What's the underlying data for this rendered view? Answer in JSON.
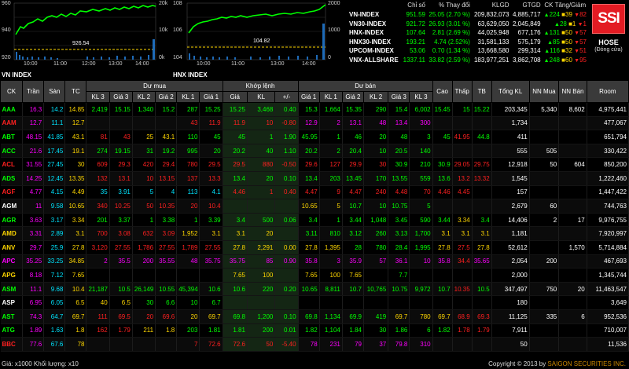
{
  "charts": [
    {
      "title": "VN INDEX",
      "y_left": [
        "960",
        "940",
        "920"
      ],
      "y_right": [
        "20k",
        "10k",
        "0k"
      ],
      "x": [
        "10:00",
        "11:00",
        "12:00",
        "13:00",
        "14:00"
      ],
      "ref_value": "926.54"
    },
    {
      "title": "HNX INDEX",
      "y_left": [
        "108",
        "106",
        "104"
      ],
      "y_right": [
        "2000",
        "1000",
        "0"
      ],
      "x": [
        "10:00",
        "11:00",
        "13:00",
        "14:00"
      ],
      "ref_value": "104.82"
    }
  ],
  "indices": {
    "headers": [
      "",
      "Chỉ số",
      "% Thay đổi",
      "KLGD",
      "GTGD",
      "CK Tăng/Giảm"
    ],
    "rows": [
      {
        "name": "VN-INDEX",
        "value": "951.59",
        "change": "25.05 (2.70 %)",
        "vol": "209,832,073",
        "val": "4,885,717",
        "up": "224",
        "ref": "39",
        "down": "82"
      },
      {
        "name": "VN30-INDEX",
        "value": "921.72",
        "change": "26.93 (3.01 %)",
        "vol": "63,629,050",
        "val": "2,045,849",
        "up": "28",
        "ref": "1",
        "down": "1"
      },
      {
        "name": "HNX-INDEX",
        "value": "107.64",
        "change": "2.81 (2.69 %)",
        "vol": "44,025,948",
        "val": "677,176",
        "up": "131",
        "ref": "50",
        "down": "57"
      },
      {
        "name": "HNX30-INDEX",
        "value": "193.21",
        "change": "4.74 (2.52%)",
        "vol": "31,581,133",
        "val": "575,179",
        "up": "85",
        "ref": "50",
        "down": "57"
      },
      {
        "name": "UPCOM-INDEX",
        "value": "53.06",
        "change": "0.70 (1.34 %)",
        "vol": "13,668,580",
        "val": "299,314",
        "up": "116",
        "ref": "32",
        "down": "51"
      },
      {
        "name": "VNX-ALLSHARE",
        "value": "1337.11",
        "change": "33.82 (2.59 %)",
        "vol": "183,977,251",
        "val": "3,862,708",
        "up": "248",
        "ref": "60",
        "down": "95"
      }
    ]
  },
  "logo": {
    "text": "SSI",
    "exchange": "HOSE",
    "status": "(Đóng cửa)"
  },
  "board": {
    "group_headers": [
      "CK",
      "Trần",
      "Sàn",
      "TC",
      "Dư mua",
      "Khớp lệnh",
      "Dư bán",
      "Cao",
      "Thấp",
      "TB",
      "Tổng KL",
      "NN Mua",
      "NN Bán",
      "Room"
    ],
    "sub_headers": [
      "KL 3",
      "Giá 3",
      "KL 2",
      "Giá 2",
      "KL 1",
      "Giá 1",
      "Giá",
      "KL",
      "+/-",
      "Giá 1",
      "KL 1",
      "Giá 2",
      "KL 2",
      "Giá 3",
      "KL 3"
    ],
    "rows": [
      [
        "AAA",
        "16.3",
        "14.2",
        "14.85",
        "2,419",
        "15.15",
        "1,340",
        "15.2",
        "287",
        "15.25",
        "15.25",
        "3,468",
        "0.40",
        "15.3",
        "1,664",
        "15.35",
        "290",
        "15.4",
        "6,002",
        "15.45",
        "15",
        "15.22",
        "203,345",
        "5,340",
        "8,602",
        "4,975,441"
      ],
      [
        "AAM",
        "12.7",
        "11.1",
        "12.7",
        "",
        "",
        "",
        "",
        "43",
        "11.9",
        "11.9",
        "10",
        "-0.80",
        "12.9",
        "2",
        "13.1",
        "48",
        "13.4",
        "300",
        "",
        "",
        "",
        "1,734",
        "",
        "",
        "477,067"
      ],
      [
        "ABT",
        "48.15",
        "41.85",
        "43.1",
        "81",
        "43",
        "25",
        "43.1",
        "110",
        "45",
        "45",
        "1",
        "1.90",
        "45.95",
        "1",
        "46",
        "20",
        "48",
        "3",
        "45",
        "41.95",
        "44.8",
        "411",
        "",
        "",
        "651,794"
      ],
      [
        "ACC",
        "21.6",
        "17.45",
        "19.1",
        "274",
        "19.15",
        "31",
        "19.2",
        "995",
        "20",
        "20.2",
        "40",
        "1.10",
        "20.2",
        "2",
        "20.4",
        "10",
        "20.5",
        "140",
        "",
        "",
        "",
        "555",
        "505",
        "",
        "330,422"
      ],
      [
        "ACL",
        "31.55",
        "27.45",
        "30",
        "609",
        "29.3",
        "420",
        "29.4",
        "780",
        "29.5",
        "29.5",
        "880",
        "-0.50",
        "29.6",
        "127",
        "29.9",
        "30",
        "30.9",
        "210",
        "30.9",
        "29.05",
        "29.75",
        "12,918",
        "50",
        "604",
        "850,200"
      ],
      [
        "ADS",
        "14.25",
        "12.45",
        "13.35",
        "132",
        "13.1",
        "10",
        "13.15",
        "137",
        "13.3",
        "13.4",
        "20",
        "0.10",
        "13.4",
        "203",
        "13.45",
        "170",
        "13.55",
        "559",
        "13.6",
        "13.2",
        "13.32",
        "1,545",
        "",
        "",
        "1,222,460"
      ],
      [
        "AGF",
        "4.77",
        "4.15",
        "4.49",
        "35",
        "3.91",
        "5",
        "4",
        "113",
        "4.1",
        "4.46",
        "1",
        "0.40",
        "4.47",
        "9",
        "4.47",
        "240",
        "4.48",
        "70",
        "4.46",
        "4.45",
        "",
        "157",
        "",
        "",
        "1,447,422"
      ],
      [
        "AGM",
        "11",
        "9.58",
        "10.65",
        "340",
        "10.25",
        "50",
        "10.35",
        "20",
        "10.4",
        "",
        "",
        "",
        "10.65",
        "5",
        "10.7",
        "10",
        "10.75",
        "5",
        "",
        "",
        "",
        "2,679",
        "60",
        "",
        "744,763"
      ],
      [
        "AGR",
        "3.63",
        "3.17",
        "3.34",
        "201",
        "3.37",
        "1",
        "3.38",
        "1",
        "3.39",
        "3.4",
        "500",
        "0.06",
        "3.4",
        "1",
        "3.44",
        "1,048",
        "3.45",
        "590",
        "3.44",
        "3.34",
        "3.4",
        "14,406",
        "2",
        "17",
        "9,976,755"
      ],
      [
        "AMD",
        "3.31",
        "2.89",
        "3.1",
        "700",
        "3.08",
        "632",
        "3.09",
        "1,952",
        "3.1",
        "3.1",
        "20",
        "",
        "3.11",
        "810",
        "3.12",
        "260",
        "3.13",
        "1,700",
        "3.1",
        "3.1",
        "3.1",
        "1,181",
        "",
        "",
        "7,920,997"
      ],
      [
        "ANV",
        "29.7",
        "25.9",
        "27.8",
        "3,120",
        "27.55",
        "1,786",
        "27.55",
        "1,789",
        "27.55",
        "27.8",
        "2,291",
        "0.00",
        "27.8",
        "1,395",
        "28",
        "780",
        "28.4",
        "1,995",
        "27.8",
        "27.5",
        "27.8",
        "52,612",
        "",
        "1,570",
        "5,714,884"
      ],
      [
        "APC",
        "35.25",
        "33.25",
        "34.85",
        "2",
        "35.5",
        "200",
        "35.55",
        "48",
        "35.75",
        "35.75",
        "85",
        "0.90",
        "35.8",
        "3",
        "35.9",
        "57",
        "36.1",
        "10",
        "35.8",
        "34.4",
        "35.65",
        "2,054",
        "200",
        "",
        "467,693"
      ],
      [
        "APG",
        "8.18",
        "7.12",
        "7.65",
        "",
        "",
        "",
        "",
        "",
        "",
        "7.65",
        "100",
        "",
        "7.65",
        "100",
        "7.65",
        "",
        "7.7",
        "",
        "",
        "",
        "",
        "2,000",
        "",
        "",
        "1,345,744"
      ],
      [
        "ASM",
        "11.1",
        "9.68",
        "10.4",
        "21,187",
        "10.5",
        "26,149",
        "10.55",
        "45,394",
        "10.6",
        "10.6",
        "220",
        "0.20",
        "10.65",
        "8,811",
        "10.7",
        "10,765",
        "10.75",
        "9,972",
        "10.7",
        "10.35",
        "10.5",
        "347,497",
        "750",
        "20",
        "11,463,547"
      ],
      [
        "ASP",
        "6.95",
        "6.05",
        "6.5",
        "40",
        "6.5",
        "30",
        "6.6",
        "10",
        "6.7",
        "",
        "",
        "",
        "",
        "",
        "",
        "",
        "",
        "",
        "",
        "",
        "",
        "180",
        "",
        "",
        "3,649"
      ],
      [
        "AST",
        "74.3",
        "64.7",
        "69.7",
        "111",
        "69.5",
        "20",
        "69.6",
        "20",
        "69.7",
        "69.8",
        "1,200",
        "0.10",
        "69.8",
        "1,134",
        "69.9",
        "419",
        "69.7",
        "780",
        "69.7",
        "68.9",
        "69.3",
        "11,125",
        "335",
        "6",
        "952,536"
      ],
      [
        "ATG",
        "1.89",
        "1.63",
        "1.8",
        "162",
        "1.79",
        "211",
        "1.8",
        "203",
        "1.81",
        "1.81",
        "200",
        "0.01",
        "1.82",
        "1,104",
        "1.84",
        "30",
        "1.86",
        "6",
        "1.82",
        "1.78",
        "1.79",
        "7,911",
        "",
        "",
        "710,007"
      ],
      [
        "BBC",
        "77.6",
        "67.6",
        "78",
        "",
        "",
        "",
        "",
        "7",
        "72.6",
        "72.6",
        "50",
        "-5.40",
        "78",
        "231",
        "79",
        "37",
        "79.8",
        "310",
        "",
        "",
        "",
        "50",
        "",
        "",
        "11,536"
      ]
    ]
  },
  "footer": {
    "left": "Giá: x1000 Khối lượng: x10",
    "right_prefix": "Copyright © 2013 by ",
    "right_brand": "SAIGON SECURITIES INC."
  }
}
